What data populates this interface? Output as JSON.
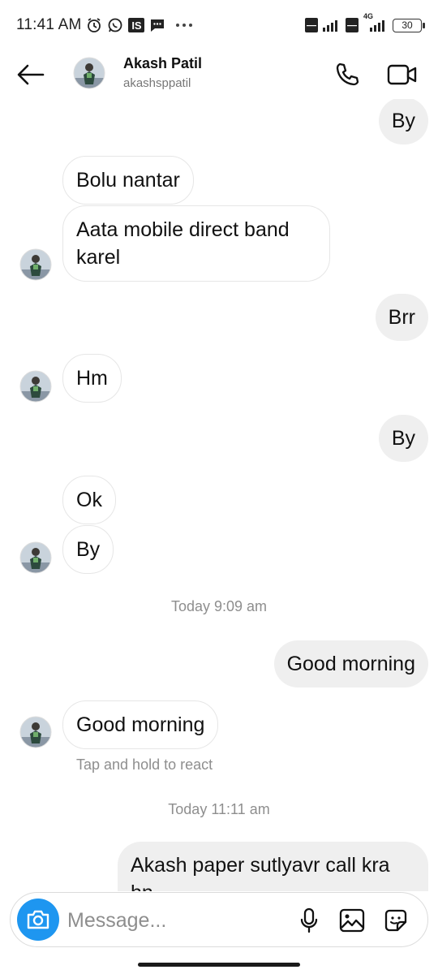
{
  "status_bar": {
    "time": "11:41 AM",
    "badge_text": "IS",
    "network_label": "4G",
    "battery": "30"
  },
  "header": {
    "name": "Akash Patil",
    "username": "akashsppatil"
  },
  "messages": [
    {
      "text": "By"
    },
    {
      "text": "Bolu nantar"
    },
    {
      "text": "Aata mobile direct band karel"
    },
    {
      "text": "Brr"
    },
    {
      "text": "Hm"
    },
    {
      "text": "By"
    },
    {
      "text": "Ok"
    },
    {
      "text": "By"
    },
    {
      "text": "Good morning"
    },
    {
      "text": "Good morning"
    },
    {
      "text": "Akash paper sutlyavr call kra hn"
    }
  ],
  "timestamps": [
    "Today 9:09 am",
    "Today 11:11 am"
  ],
  "react_hint": "Tap and hold to react",
  "composer": {
    "placeholder": "Message..."
  },
  "colors": {
    "accent": "#1e96f0",
    "outgoing_bubble": "#efefef",
    "muted_text": "#8e8e8e"
  }
}
